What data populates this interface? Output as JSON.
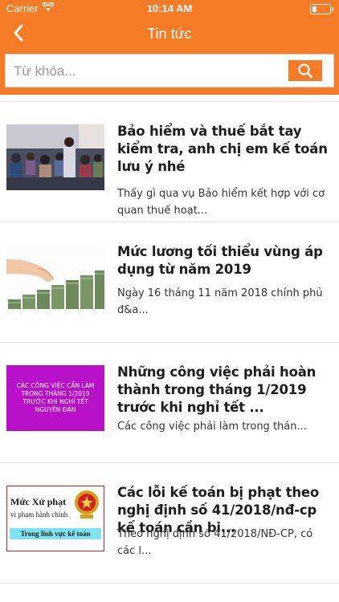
{
  "status_bar": {
    "carrier": "Carrier",
    "time": "10:14 AM"
  },
  "header": {
    "title": "Tin tức",
    "back_icon": "chevron-left-icon",
    "color": "#f57b26"
  },
  "search": {
    "placeholder": "Từ khóa...",
    "value": "",
    "button_icon": "search-icon"
  },
  "news": [
    {
      "title": "Bảo hiểm và thuế bắt tay kiểm tra, anh chị em kế toán lưu ý nhé",
      "description": "Thấy gì qua vụ Bảo hiểm kết hợp với cơ quan thuế hoạt...",
      "thumbnail": "meeting-photo"
    },
    {
      "title": "Mức lương tối thiểu vùng áp dụng từ năm 2019",
      "description": "Ngày 16 tháng 11 năm 2018 chính phủ đ&a...",
      "thumbnail": "money-stack-photo"
    },
    {
      "title": "Những công việc phải hoàn thành trong tháng 1/2019 trước khi nghỉ tết ...",
      "description": "Các công việc phải làm trong thán...",
      "thumbnail": "purple-banner",
      "thumb_text": "CÁC CÔNG VIỆC CẦN LÀM TRONG THÁNG 1/2019 TRƯỚC KHI NGHỈ TẾT NGUYÊN ĐÁN"
    },
    {
      "title": "Các lỗi kế toán bị phạt theo nghị định số 41/2018/nđ-cp kế toán cần bi...",
      "description": "Theo nghị định số 41/2018/NĐ-CP, có các l...",
      "thumbnail": "penalty-banner",
      "thumb_line1": "Mức Xử phạt",
      "thumb_line2": "vi phạm hành chính",
      "thumb_line3": "Trong lĩnh vực kế toán"
    }
  ]
}
